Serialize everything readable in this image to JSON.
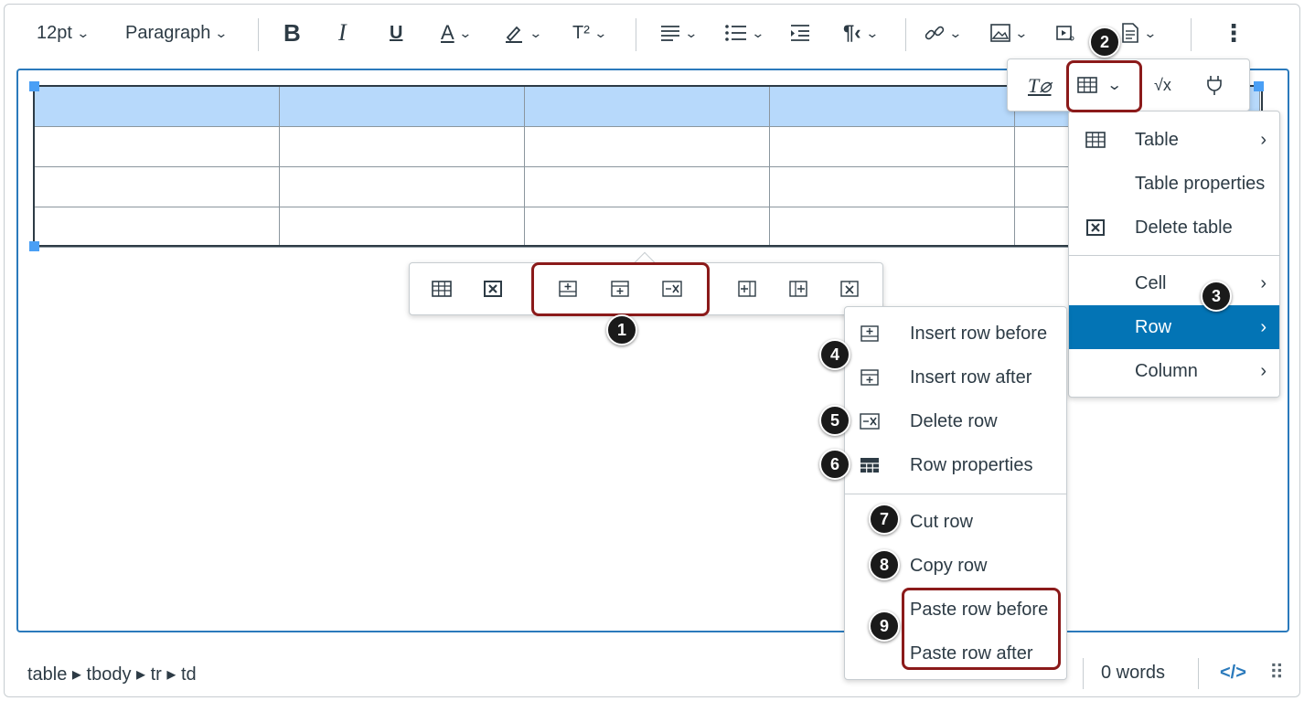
{
  "toolbar": {
    "font_size": "12pt",
    "block_format": "Paragraph",
    "bold": "B",
    "italic": "I",
    "underline": "U",
    "text_color": "A",
    "superscript": "T²"
  },
  "table_toolbar": {
    "icons": [
      "table-properties-icon",
      "delete-table-icon",
      "insert-row-before-icon",
      "insert-row-after-icon",
      "delete-row-icon",
      "insert-column-before-icon",
      "insert-column-after-icon",
      "delete-column-icon"
    ]
  },
  "main_menu": {
    "items": [
      {
        "label": "Table",
        "has_submenu": true
      },
      {
        "label": "Table properties",
        "has_submenu": false
      },
      {
        "label": "Delete table",
        "has_submenu": false
      },
      {
        "label": "Cell",
        "has_submenu": true
      },
      {
        "label": "Row",
        "has_submenu": true,
        "active": true
      },
      {
        "label": "Column",
        "has_submenu": true
      }
    ]
  },
  "row_submenu": {
    "items": [
      {
        "label": "Insert row before"
      },
      {
        "label": "Insert row after"
      },
      {
        "label": "Delete row"
      },
      {
        "label": "Row properties"
      },
      {
        "label": "Cut row"
      },
      {
        "label": "Copy row"
      },
      {
        "label": "Paste row before"
      },
      {
        "label": "Paste row after"
      }
    ]
  },
  "status": {
    "path": "table ▸ tbody ▸ tr ▸ td",
    "word_count": "0 words",
    "code_toggle": "</>"
  },
  "callouts": [
    "1",
    "2",
    "3",
    "4",
    "5",
    "6",
    "7",
    "8",
    "9"
  ],
  "colors": {
    "accent": "#0374b5",
    "editor_border": "#2b7abc",
    "header_row": "#b7d9fb",
    "highlight": "#8b1a1a",
    "handle": "#4a9ff5"
  }
}
